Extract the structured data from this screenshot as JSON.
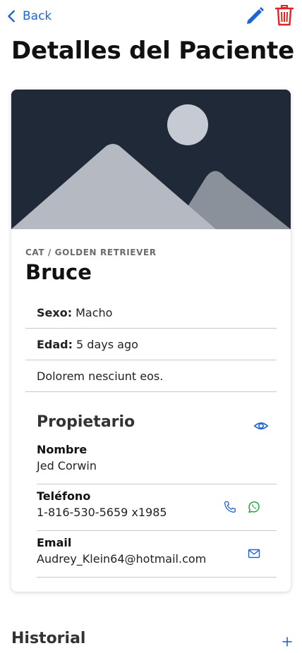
{
  "nav": {
    "back_label": "Back",
    "back_icon": "chevron-left-icon",
    "edit_icon": "pencil-icon",
    "delete_icon": "trash-icon"
  },
  "page": {
    "title": "Detalles del Paciente"
  },
  "patient": {
    "image_icon": "image-placeholder-icon",
    "breed": "CAT / GOLDEN RETRIEVER",
    "name": "Bruce",
    "sex_label": "Sexo:",
    "sex": "Macho",
    "age_label": "Edad:",
    "age": "5 days ago",
    "notes": "Dolorem nesciunt eos."
  },
  "owner": {
    "title": "Propietario",
    "view_icon": "eye-icon",
    "name_label": "Nombre",
    "name": "Jed Corwin",
    "phone_label": "Teléfono",
    "phone": "1-816-530-5659 x1985",
    "phone_icon": "phone-icon",
    "whatsapp_icon": "whatsapp-icon",
    "email_label": "Email",
    "email": "Audrey_Klein64@hotmail.com",
    "email_icon": "mail-icon"
  },
  "history": {
    "title": "Historial",
    "add_icon": "plus-icon"
  },
  "colors": {
    "accent": "#1a66d9",
    "danger": "#e02424",
    "whatsapp": "#25a244",
    "hero_bg": "#1f2937"
  }
}
